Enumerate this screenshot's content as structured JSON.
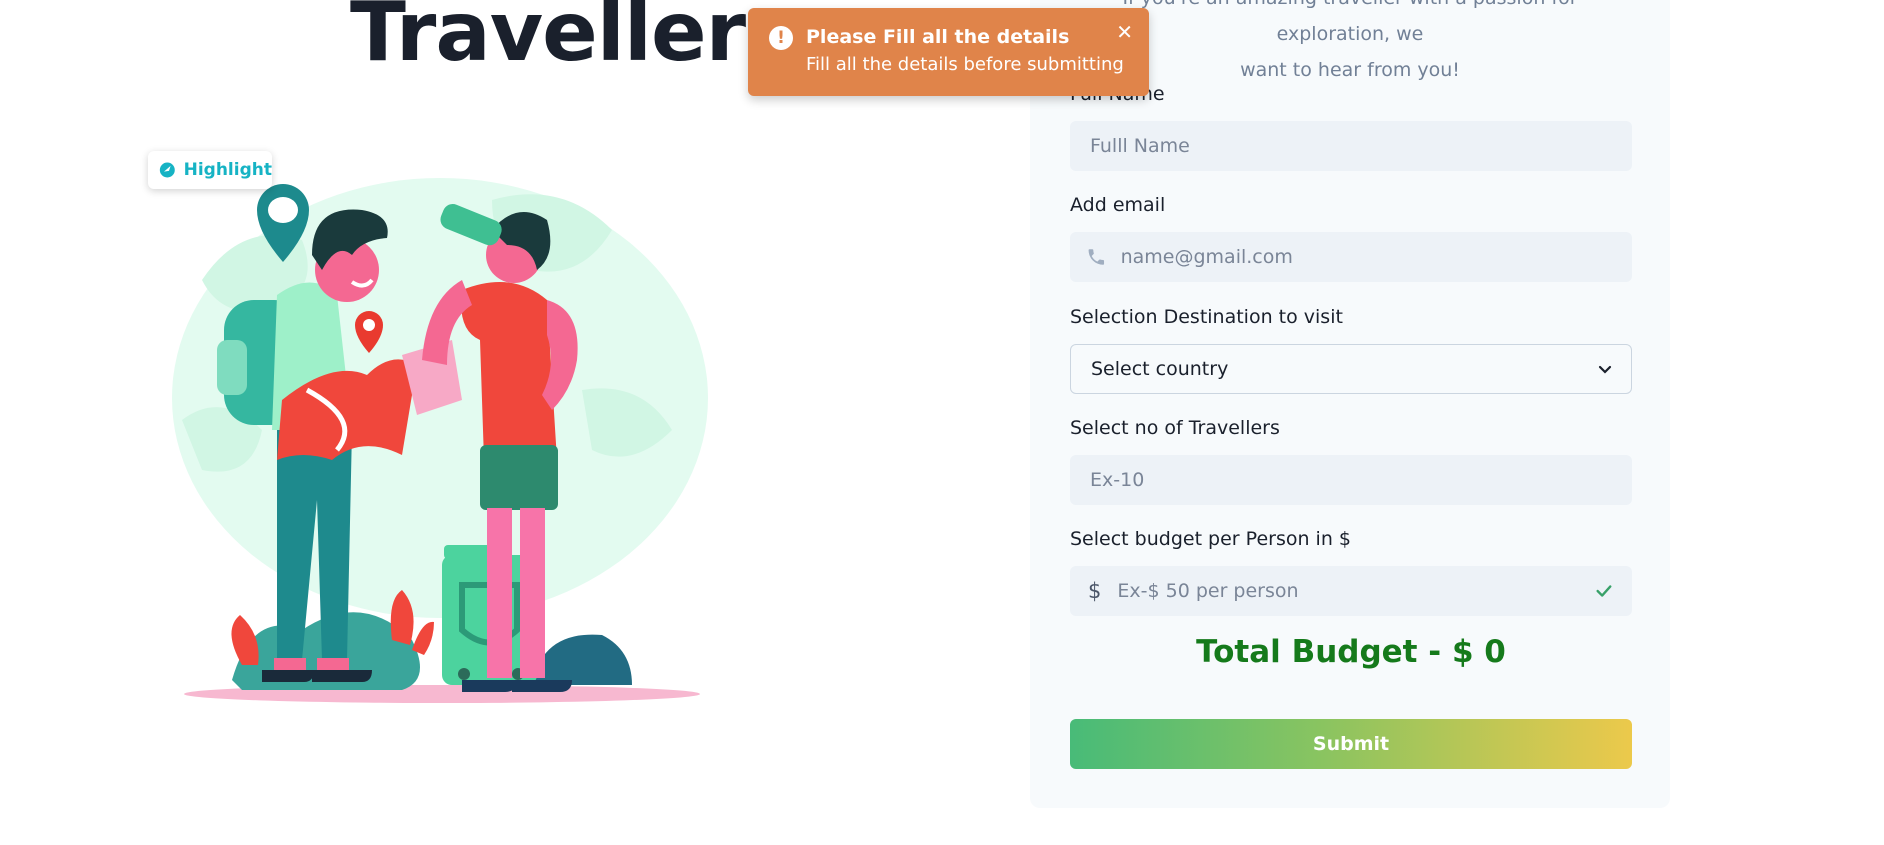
{
  "hero": {
    "title": "Travellers",
    "badge_label": "Highlight"
  },
  "toast": {
    "title": "Please Fill all the details",
    "description": "Fill all the details before submitting",
    "icon": "alert-circle-icon",
    "close_icon": "close-icon",
    "color": "#e0844a"
  },
  "form": {
    "intro_line1": "If you're an amazing traveller with a passion for exploration, we",
    "intro_line2": "want to hear from you!",
    "full_name": {
      "label": "Full Name",
      "placeholder": "Fulll Name",
      "value": ""
    },
    "email": {
      "label": "Add email",
      "placeholder": "name@gmail.com",
      "value": "",
      "icon": "phone-icon"
    },
    "destination": {
      "label": "Selection Destination to visit",
      "selected": "Select country",
      "icon": "chevron-down-icon"
    },
    "travellers": {
      "label": "Select no of Travellers",
      "placeholder": "Ex-10",
      "value": ""
    },
    "budget": {
      "label": "Select budget per Person in $",
      "prefix": "$",
      "placeholder": "Ex-$ 50 per person",
      "value": "",
      "icon": "check-icon"
    },
    "total": "Total Budget - $ 0",
    "submit_label": "Submit"
  },
  "colors": {
    "total_green": "#157a1b",
    "accent_cyan": "#16b3c4",
    "submit_gradient_start": "#48bb78",
    "submit_gradient_end": "#ecc94b"
  }
}
